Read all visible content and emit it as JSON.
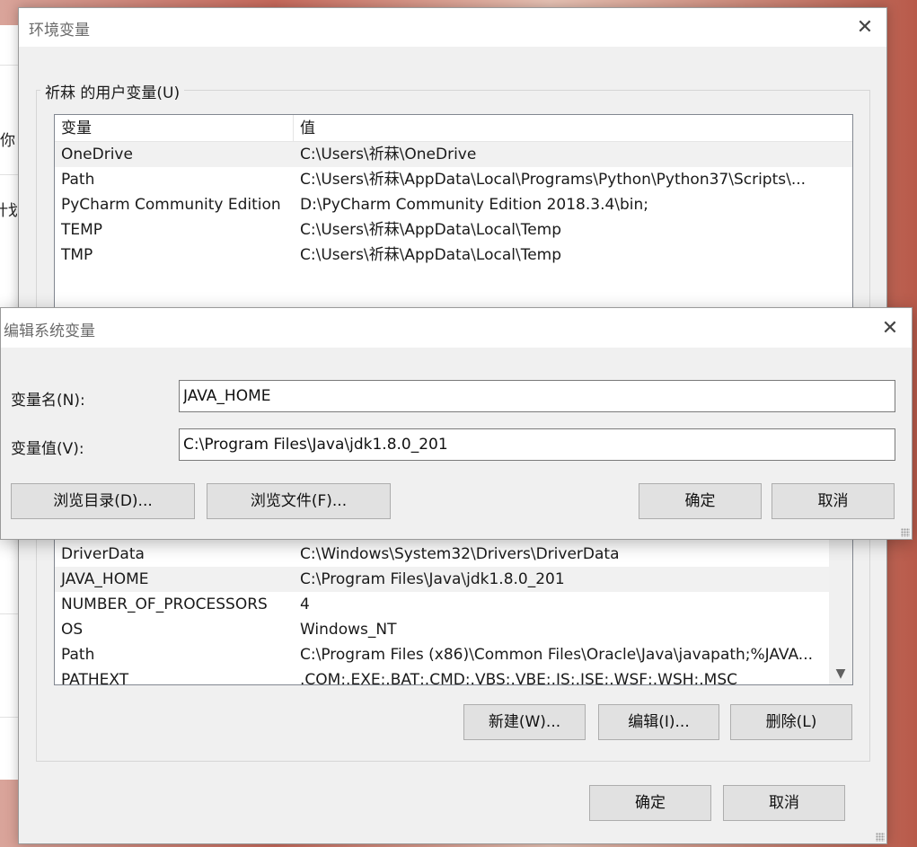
{
  "background": {
    "fragments": [
      "你",
      "计划"
    ]
  },
  "env_dialog": {
    "title": "环境变量",
    "user_group_label": "祈菻 的用户变量(U)",
    "columns": [
      "变量",
      "值"
    ],
    "user_vars": [
      {
        "name": "OneDrive",
        "value": "C:\\Users\\祈菻\\OneDrive"
      },
      {
        "name": "Path",
        "value": "C:\\Users\\祈菻\\AppData\\Local\\Programs\\Python\\Python37\\Scripts\\..."
      },
      {
        "name": "PyCharm Community Edition",
        "value": "D:\\PyCharm Community Edition 2018.3.4\\bin;"
      },
      {
        "name": "TEMP",
        "value": "C:\\Users\\祈菻\\AppData\\Local\\Temp"
      },
      {
        "name": "TMP",
        "value": "C:\\Users\\祈菻\\AppData\\Local\\Temp"
      }
    ],
    "system_vars": [
      {
        "name": "DriverData",
        "value": "C:\\Windows\\System32\\Drivers\\DriverData"
      },
      {
        "name": "JAVA_HOME",
        "value": "C:\\Program Files\\Java\\jdk1.8.0_201"
      },
      {
        "name": "NUMBER_OF_PROCESSORS",
        "value": "4"
      },
      {
        "name": "OS",
        "value": "Windows_NT"
      },
      {
        "name": "Path",
        "value": "C:\\Program Files (x86)\\Common Files\\Oracle\\Java\\javapath;%JAVA..."
      },
      {
        "name": "PATHEXT",
        "value": ".COM;.EXE;.BAT;.CMD;.VBS;.VBE;.JS;.JSE;.WSF;.WSH;.MSC"
      }
    ],
    "buttons": {
      "new": "新建(W)...",
      "edit": "编辑(I)...",
      "delete": "删除(L)",
      "ok": "确定",
      "cancel": "取消"
    }
  },
  "edit_dialog": {
    "title": "编辑系统变量",
    "name_label": "变量名(N):",
    "name_value": "JAVA_HOME",
    "value_label": "变量值(V):",
    "value_value": "C:\\Program Files\\Java\\jdk1.8.0_201",
    "buttons": {
      "browse_dir": "浏览目录(D)...",
      "browse_file": "浏览文件(F)...",
      "ok": "确定",
      "cancel": "取消"
    }
  },
  "icons": {
    "close": "close-icon",
    "scroll_down": "chevron-down-icon",
    "resize": "resize-grip-icon"
  }
}
